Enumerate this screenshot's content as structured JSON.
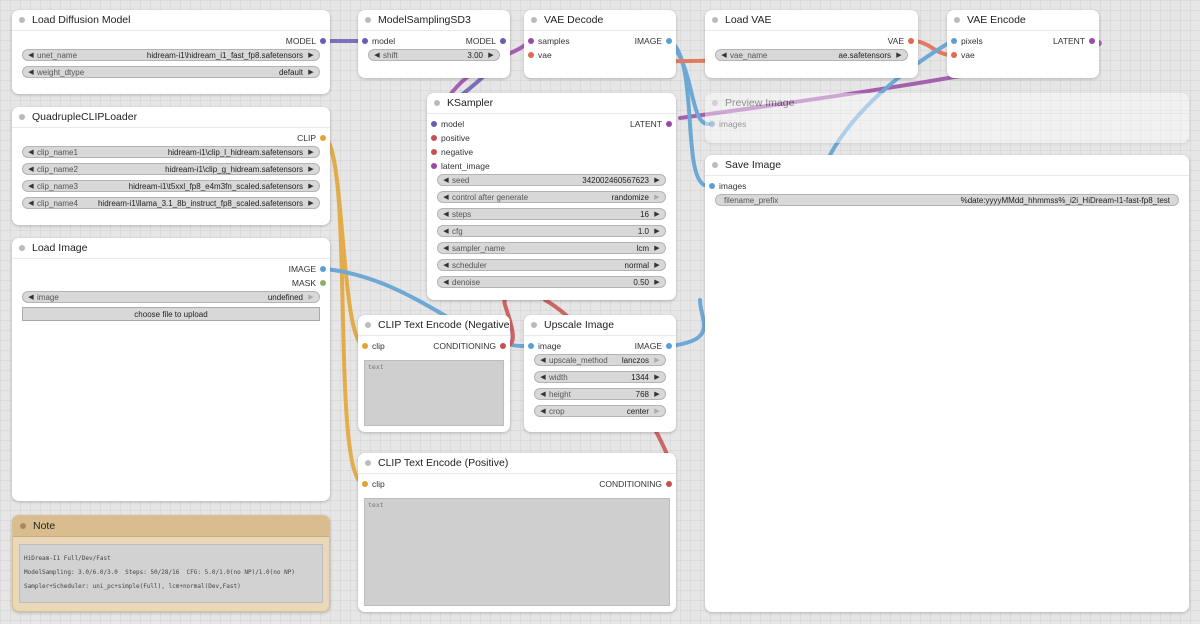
{
  "colors": {
    "model": "#6b5bb3",
    "clip": "#e2a331",
    "vae": "#e06a4a",
    "conditioning": "#c75050",
    "latent": "#9a4aa6",
    "image": "#5a9fd4",
    "mask": "#8cb064",
    "int": "#6aa86a"
  },
  "nodes": {
    "load_diffusion": {
      "title": "Load Diffusion Model",
      "out_model": "MODEL",
      "w_unet_name": "unet_name",
      "v_unet_name": "hidream-i1\\hidream_i1_fast_fp8.safetensors",
      "w_weight_dtype": "weight_dtype",
      "v_weight_dtype": "default"
    },
    "model_sampling": {
      "title": "ModelSamplingSD3",
      "in_model": "model",
      "out_model": "MODEL",
      "w_shift": "shift",
      "v_shift": "3.00"
    },
    "vae_decode": {
      "title": "VAE Decode",
      "in_samples": "samples",
      "in_vae": "vae",
      "out_image": "IMAGE"
    },
    "load_vae": {
      "title": "Load VAE",
      "out_vae": "VAE",
      "w_vae_name": "vae_name",
      "v_vae_name": "ae.safetensors"
    },
    "vae_encode": {
      "title": "VAE Encode",
      "in_pixels": "pixels",
      "in_vae": "vae",
      "out_latent": "LATENT"
    },
    "quad_clip": {
      "title": "QuadrupleCLIPLoader",
      "out_clip": "CLIP",
      "w_clip1": "clip_name1",
      "v_clip1": "hidream-i1\\clip_l_hidream.safetensors",
      "w_clip2": "clip_name2",
      "v_clip2": "hidream-i1\\clip_g_hidream.safetensors",
      "w_clip3": "clip_name3",
      "v_clip3": "hidream-i1\\t5xxl_fp8_e4m3fn_scaled.safetensors",
      "w_clip4": "clip_name4",
      "v_clip4": "hidream-i1\\llama_3.1_8b_instruct_fp8_scaled.safetensors"
    },
    "ksampler": {
      "title": "KSampler",
      "in_model": "model",
      "in_positive": "positive",
      "in_negative": "negative",
      "in_latent": "latent_image",
      "out_latent": "LATENT",
      "w_seed": "seed",
      "v_seed": "342002460567623",
      "w_control": "control after generate",
      "v_control": "randomize",
      "w_steps": "steps",
      "v_steps": "16",
      "w_cfg": "cfg",
      "v_cfg": "1.0",
      "w_sampler": "sampler_name",
      "v_sampler": "lcm",
      "w_scheduler": "scheduler",
      "v_scheduler": "normal",
      "w_denoise": "denoise",
      "v_denoise": "0.50"
    },
    "preview_image": {
      "title": "Preview Image",
      "in_images": "images"
    },
    "save_image": {
      "title": "Save Image",
      "in_images": "images",
      "w_prefix": "filename_prefix",
      "v_prefix": "%date:yyyyMMdd_hhmmss%_i2i_HiDream-I1-fast-fp8_test"
    },
    "load_image": {
      "title": "Load Image",
      "out_image": "IMAGE",
      "out_mask": "MASK",
      "w_image": "image",
      "v_image": "undefined",
      "upload": "choose file to upload"
    },
    "clip_neg": {
      "title": "CLIP Text Encode (Negative)",
      "in_clip": "clip",
      "out_cond": "CONDITIONING",
      "placeholder": "text"
    },
    "upscale": {
      "title": "Upscale Image",
      "in_image": "image",
      "out_image": "IMAGE",
      "w_method": "upscale_method",
      "v_method": "lanczos",
      "w_width": "width",
      "v_width": "1344",
      "w_height": "height",
      "v_height": "768",
      "w_crop": "crop",
      "v_crop": "center"
    },
    "clip_pos": {
      "title": "CLIP Text Encode (Positive)",
      "in_clip": "clip",
      "out_cond": "CONDITIONING",
      "placeholder": "text"
    },
    "note": {
      "title": "Note",
      "line1": "HiDream-I1 Full/Dev/Fast",
      "line2": "ModelSampling: 3.0/6.0/3.0  Steps: 50/28/16  CFG: 5.0/1.0(no NP)/1.0(no NP)",
      "line3": "Sampler+Scheduler: uni_pc+simple(Full), lcm+normal(Dev,Fast)"
    }
  }
}
